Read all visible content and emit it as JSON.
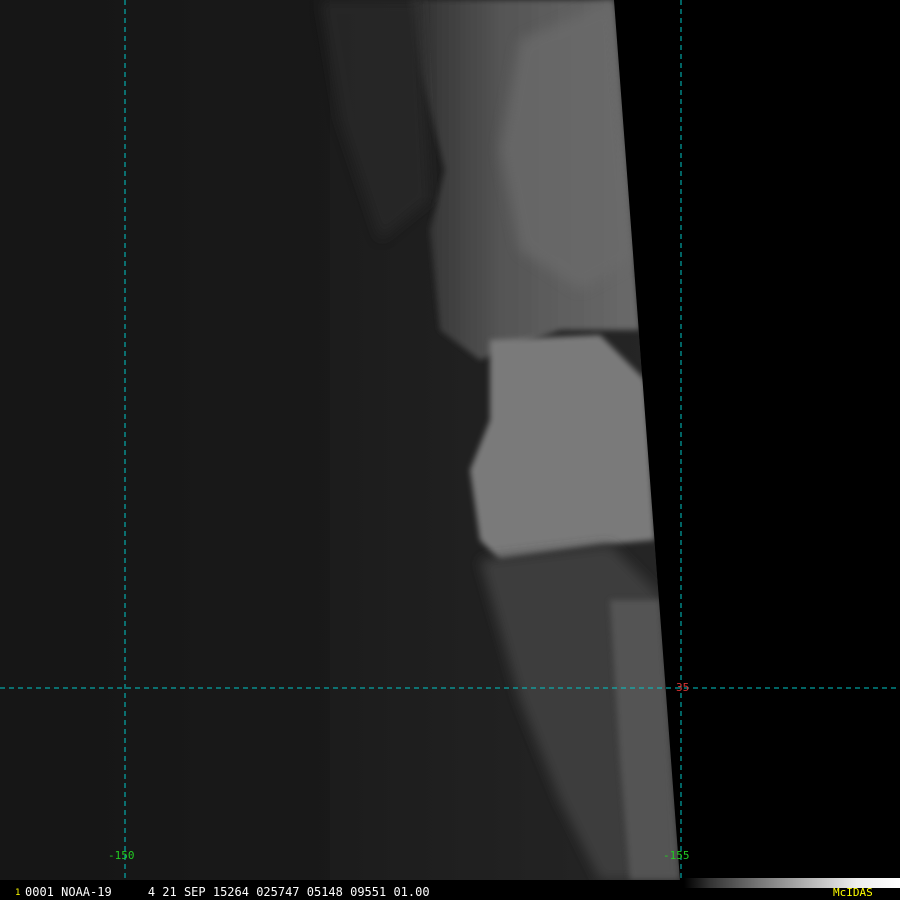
{
  "image": {
    "description_colors": {
      "background": "#000000",
      "grid_line": "#00c8c8",
      "longitude_label": "#22cc22",
      "latitude_label": "#dd3333",
      "status_text": "#ffffff",
      "logo_text": "#ffff00"
    }
  },
  "grid": {
    "longitude_labels": [
      "-150",
      "-155"
    ],
    "latitude_labels": [
      "35"
    ]
  },
  "status_bar": {
    "frame_marker": "1",
    "text": "0001 NOAA-19     4 21 SEP 15264 025747 05148 09551 01.00",
    "logo": "McIDAS"
  }
}
